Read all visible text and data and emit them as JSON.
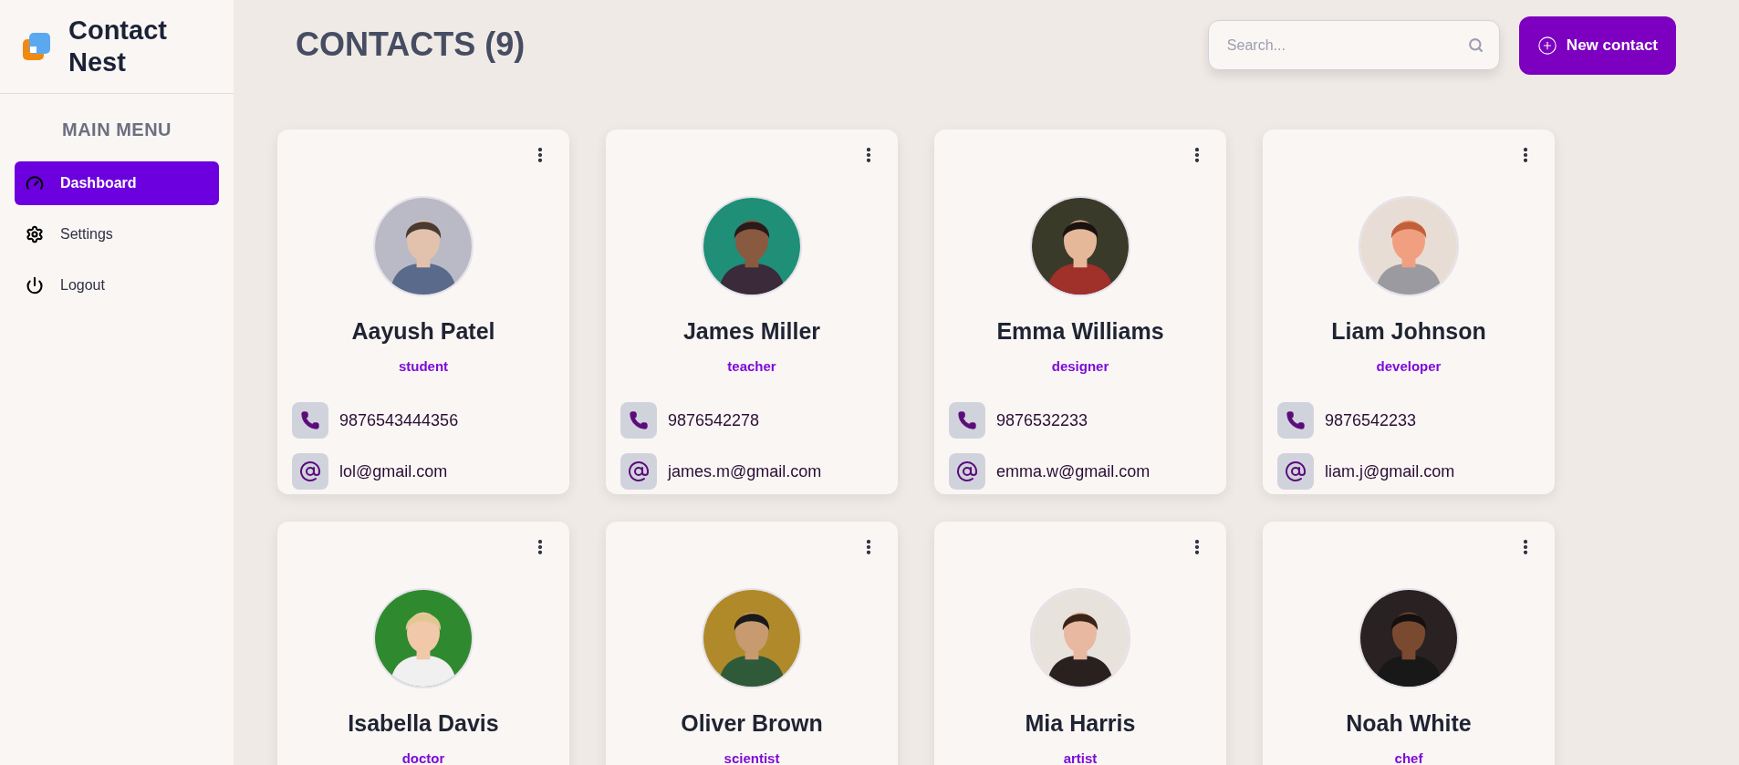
{
  "brand": {
    "name": "Contact Nest"
  },
  "sidebar": {
    "heading": "MAIN MENU",
    "items": [
      {
        "kind": "dashboard",
        "label": "Dashboard",
        "selected": true
      },
      {
        "kind": "settings",
        "label": "Settings",
        "selected": false
      },
      {
        "kind": "logout",
        "label": "Logout",
        "selected": false
      }
    ]
  },
  "header": {
    "title": "CONTACTS (9)",
    "search": {
      "placeholder": "Search..."
    },
    "new_button": "New contact"
  },
  "contacts": [
    {
      "name": "Aayush Patel",
      "role": "student",
      "phone": "9876543444356",
      "email": "lol@gmail.com"
    },
    {
      "name": "James Miller",
      "role": "teacher",
      "phone": "9876542278",
      "email": "james.m@gmail.com"
    },
    {
      "name": "Emma Williams",
      "role": "designer",
      "phone": "9876532233",
      "email": "emma.w@gmail.com"
    },
    {
      "name": "Liam Johnson",
      "role": "developer",
      "phone": "9876542233",
      "email": "liam.j@gmail.com"
    },
    {
      "name": "Isabella Davis",
      "role": "doctor"
    },
    {
      "name": "Oliver Brown",
      "role": "scientist"
    },
    {
      "name": "Mia Harris",
      "role": "artist"
    },
    {
      "name": "Noah White",
      "role": "chef"
    }
  ]
}
